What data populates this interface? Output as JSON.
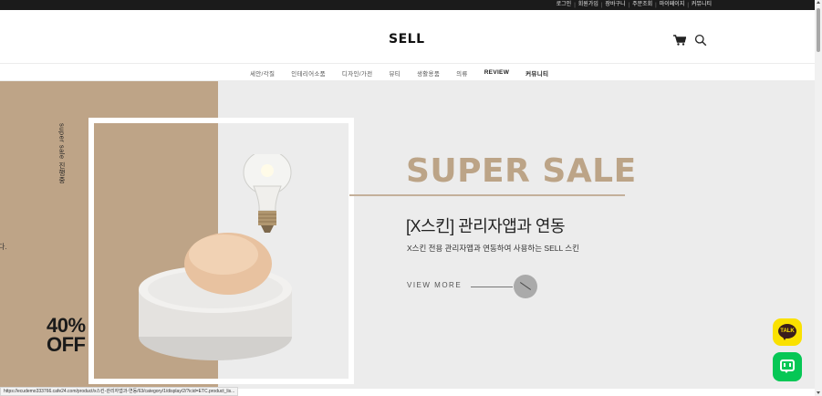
{
  "top_links": [
    "로그인",
    "회원가입",
    "장바구니",
    "주문조회",
    "마이페이지",
    "커뮤니티"
  ],
  "logo": "SELL",
  "icons": {
    "cart": "cart-icon",
    "search": "search-icon",
    "kakao": "kakaotalk-icon",
    "line": "line-chat-icon"
  },
  "nav": {
    "items": [
      "세안/각질",
      "인테리어소품",
      "디자인/가전",
      "뷰티",
      "생활용품",
      "의류",
      "REVIEW",
      "커뮤니티"
    ]
  },
  "banner": {
    "vertical_text": "super sale 진행중",
    "clipped_text": "다.",
    "percent_line1": "40%",
    "percent_line2": "OFF",
    "sale_title": "SUPER SALE",
    "subtitle": "[X스킨] 관리자앱과 연동",
    "description": "X스킨 전용 관리자앱과 연동하여 사용하는 SELL 스킨",
    "view_more": "VIEW MORE"
  },
  "kakao_label": "TALK",
  "status_url": "https://ecudemo333766.cafe24.com/product/x스킨-관리자앱과-연동/63/category/1/display/2/?icid=ETC.product_lis...",
  "colors": {
    "topbar": "#1b1b1b",
    "tan": "#bea487",
    "hero_bg": "#ececec",
    "sale_title": "#bca487",
    "kakao": "#fae100",
    "line": "#06c755"
  }
}
